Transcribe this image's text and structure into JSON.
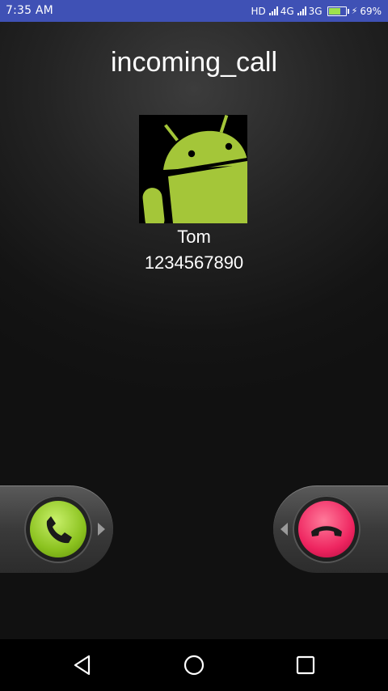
{
  "status_bar": {
    "time": "7:35 AM",
    "network_hd": "HD",
    "network_4g": "4G",
    "network_3g": "3G",
    "battery_percent": "69%",
    "battery_level": 0.69,
    "background": "#3f51b5"
  },
  "screen": {
    "title": "incoming_call"
  },
  "caller": {
    "name": "Tom",
    "number": "1234567890",
    "avatar_icon": "android-robot-icon"
  },
  "actions": {
    "answer_icon": "phone-answer-icon",
    "answer_color": "#8bc21f",
    "decline_icon": "phone-hangup-icon",
    "decline_color": "#ee2560"
  },
  "nav_bar": {
    "back_icon": "back-triangle-icon",
    "home_icon": "home-circle-icon",
    "recents_icon": "recents-square-icon"
  }
}
